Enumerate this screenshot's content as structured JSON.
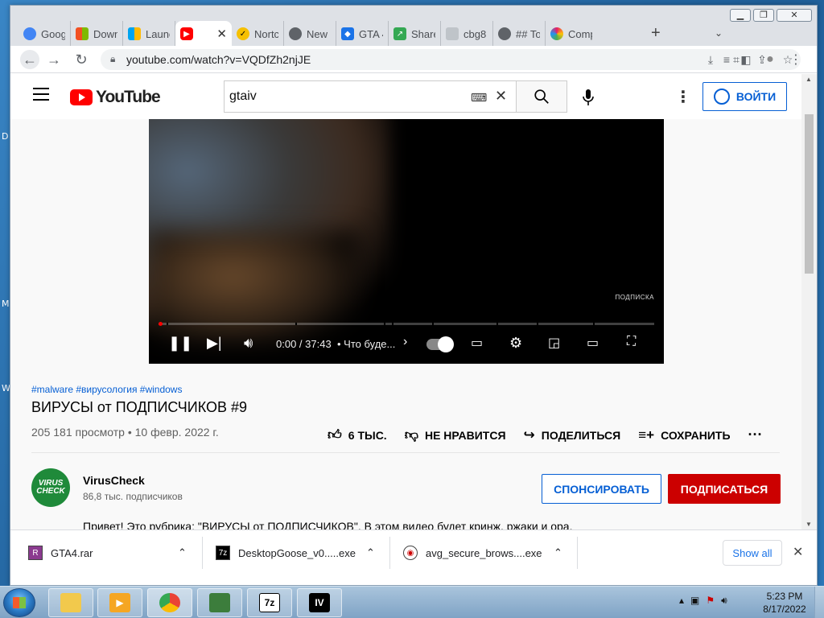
{
  "browser": {
    "tabs": [
      {
        "title": "Goog",
        "icon": "google-icon",
        "color": "#4285f4"
      },
      {
        "title": "Down",
        "icon": "microsoft-icon",
        "color": "#f25022"
      },
      {
        "title": "Launc",
        "icon": "microsoft-icon",
        "color": "#f25022"
      },
      {
        "title": "",
        "icon": "youtube-icon",
        "color": "#ff0000",
        "active": true
      },
      {
        "title": "Nortc",
        "icon": "norton-icon",
        "color": "#f6c000"
      },
      {
        "title": "New",
        "icon": "chrome-icon",
        "color": "#5f6368"
      },
      {
        "title": "GTA 4",
        "icon": "gamepad-icon",
        "color": "#1a73e8"
      },
      {
        "title": "Share",
        "icon": "share-icon",
        "color": "#34a853"
      },
      {
        "title": "cbg8",
        "icon": "file-icon",
        "color": "#9aa0a6"
      },
      {
        "title": "## To",
        "icon": "globe-icon",
        "color": "#5f6368"
      },
      {
        "title": "Comp",
        "icon": "colorful-icon",
        "color": "#e91e63"
      }
    ],
    "active_tab_close": "✕",
    "new_tab": "+",
    "tab_list": "⌄",
    "url": "youtube.com/watch?v=VQDfZh2njJE"
  },
  "youtube": {
    "logo_text": "YouTube",
    "search_value": "gtaiv",
    "sign_in": "ВОЙТИ",
    "player": {
      "watermark": "ПОДПИСКА",
      "time": "0:00 / 37:43",
      "chapter": "• Что буде...",
      "progress": 0
    },
    "tags": "#malware #вирусология #windows",
    "title": "ВИРУСЫ от ПОДПИСЧИКОВ #9",
    "meta": "205 181 просмотр • 10 февр. 2022 г.",
    "actions": {
      "like": "6 ТЫС.",
      "dislike": "НЕ НРАВИТСЯ",
      "share": "ПОДЕЛИТЬСЯ",
      "save": "СОХРАНИТЬ"
    },
    "channel": {
      "avatar_line1": "VIRUS",
      "avatar_line2": "CHECK",
      "name": "VirusCheck",
      "subs": "86,8 тыс. подписчиков",
      "sponsor": "СПОНСИРОВАТЬ",
      "subscribe": "ПОДПИСАТЬСЯ"
    },
    "description": "Привет! Это рубрика: \"ВИРУСЫ от ПОДПИСЧИКОВ\". В этом видео будет кринж, ржаки и ора."
  },
  "downloads": {
    "items": [
      {
        "name": "GTA4.rar",
        "icon": "winrar-icon"
      },
      {
        "name": "DesktopGoose_v0.....exe",
        "icon": "7z-icon"
      },
      {
        "name": "avg_secure_brows....exe",
        "icon": "avg-icon"
      }
    ],
    "show_all": "Show all"
  },
  "desktop": {
    "letters": [
      "D",
      "M",
      "W"
    ]
  },
  "taskbar": {
    "items": [
      {
        "icon": "explorer-icon"
      },
      {
        "icon": "media-player-icon"
      },
      {
        "icon": "chrome-icon",
        "active": true
      },
      {
        "icon": "task-manager-icon"
      },
      {
        "icon": "7zip-icon",
        "label": "7z"
      },
      {
        "icon": "gta-iv-icon",
        "label": "IV"
      }
    ],
    "time": "5:23 PM",
    "date": "8/17/2022"
  }
}
